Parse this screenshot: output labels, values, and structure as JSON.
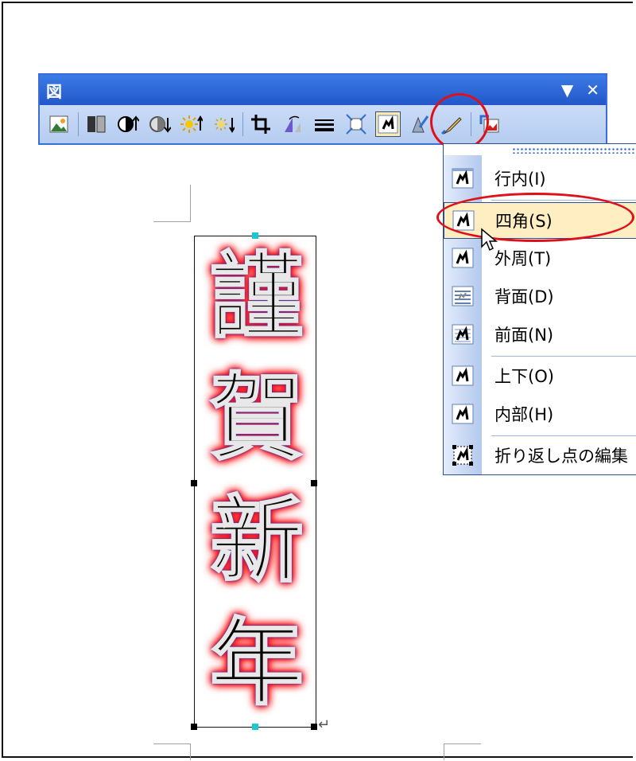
{
  "toolbar": {
    "title": "図",
    "dropdown_arrow": "▼",
    "close": "✕",
    "buttons": [
      {
        "name": "insert-picture-icon"
      },
      {
        "name": "color-icon"
      },
      {
        "name": "more-contrast-icon"
      },
      {
        "name": "less-contrast-icon"
      },
      {
        "name": "more-brightness-icon"
      },
      {
        "name": "less-brightness-icon"
      },
      {
        "name": "crop-icon"
      },
      {
        "name": "rotate-icon"
      },
      {
        "name": "line-style-icon"
      },
      {
        "name": "compress-picture-icon"
      },
      {
        "name": "text-wrapping-icon"
      },
      {
        "name": "format-picture-icon"
      },
      {
        "name": "set-transparent-color-icon"
      },
      {
        "name": "reset-picture-icon"
      }
    ]
  },
  "wrap_menu": {
    "items": [
      {
        "label": "行内(I)",
        "icon": "wrap-inline-icon"
      },
      {
        "label": "四角(S)",
        "icon": "wrap-square-icon",
        "highlighted": true
      },
      {
        "label": "外周(T)",
        "icon": "wrap-tight-icon"
      },
      {
        "label": "背面(D)",
        "icon": "wrap-behind-text-icon"
      },
      {
        "label": "前面(N)",
        "icon": "wrap-in-front-icon"
      },
      {
        "label": "上下(O)",
        "icon": "wrap-top-bottom-icon"
      },
      {
        "label": "内部(H)",
        "icon": "wrap-through-icon"
      },
      {
        "label": "折り返し点の編集",
        "icon": "edit-wrap-points-icon"
      }
    ]
  },
  "banner": {
    "characters": [
      "謹",
      "賀",
      "新",
      "年"
    ]
  },
  "paragraph_mark": "↵"
}
